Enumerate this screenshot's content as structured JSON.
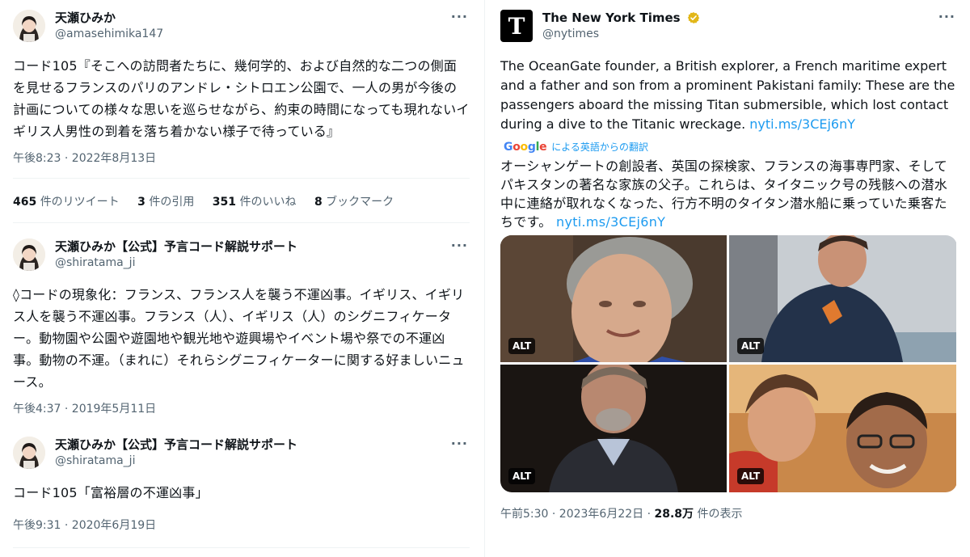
{
  "left_tweets": [
    {
      "display_name": "天瀬ひみか",
      "handle": "@amasehimika147",
      "text": "コード105『そこへの訪問者たちに、幾何学的、および自然的な二つの側面を見せるフランスのパリのアンドレ・シトロエン公園で、一人の男が今後の計画についての様々な思いを巡らせながら、約束の時間になっても現れないイギリス人男性の到着を落ち着かない様子で待っている』",
      "timestamp": "午後8:23 · 2022年8月13日",
      "stats": {
        "retweets_count": "465",
        "retweets_label": "件のリツイート",
        "quotes_count": "3",
        "quotes_label": "件の引用",
        "likes_count": "351",
        "likes_label": "件のいいね",
        "bookmarks_count": "8",
        "bookmarks_label": "ブックマーク"
      }
    },
    {
      "display_name": "天瀬ひみか【公式】予言コード解説サポート",
      "handle": "@shiratama_ji",
      "text": "◊コードの現象化：フランス、フランス人を襲う不運凶事。イギリス、イギリス人を襲う不運凶事。フランス（人）、イギリス（人）のシグニフィケーター。動物園や公園や遊園地や観光地や遊興場やイベント場や祭での不運凶事。動物の不運。（まれに）それらシグニフィケーターに関する好ましいニュース。",
      "timestamp": "午後4:37 · 2019年5月11日"
    },
    {
      "display_name": "天瀬ひみか【公式】予言コード解説サポート",
      "handle": "@shiratama_ji",
      "text": "コード105「富裕層の不運凶事」",
      "timestamp": "午後9:31 · 2020年6月19日"
    }
  ],
  "right_tweet": {
    "display_name": "The New York Times",
    "handle": "@nytimes",
    "logo_glyph": "T",
    "text": "The OceanGate founder, a British explorer, a French maritime expert and a father and son from a prominent Pakistani family: These are the passengers aboard the missing Titan submersible, which lost contact during a dive to the Titanic wreckage.",
    "link": "nyti.ms/3CEj6nY",
    "translation_brand": "Google",
    "translation_label": "による英語からの翻訳",
    "translated_text": "オーシャンゲートの創設者、英国の探検家、フランスの海事専門家、そしてパキスタンの著名な家族の父子。これらは、タイタニック号の残骸への潜水中に連絡が取れなくなった、行方不明のタイタン潜水船に乗っていた乗客たちです。",
    "translated_link": "nyti.ms/3CEj6nY",
    "media_alt_badges": [
      "ALT",
      "ALT",
      "ALT",
      "ALT"
    ],
    "time": "午前5:30 · 2023年6月22日 · ",
    "views_count": "28.8万",
    "views_label": "件の表示"
  },
  "colors": {
    "link": "#1d9bf0",
    "secondary_text": "#536471",
    "divider": "#eff3f4",
    "verified_badge": "#e2b719"
  },
  "icons": [
    "more-icon",
    "verified-icon",
    "google-logo"
  ]
}
